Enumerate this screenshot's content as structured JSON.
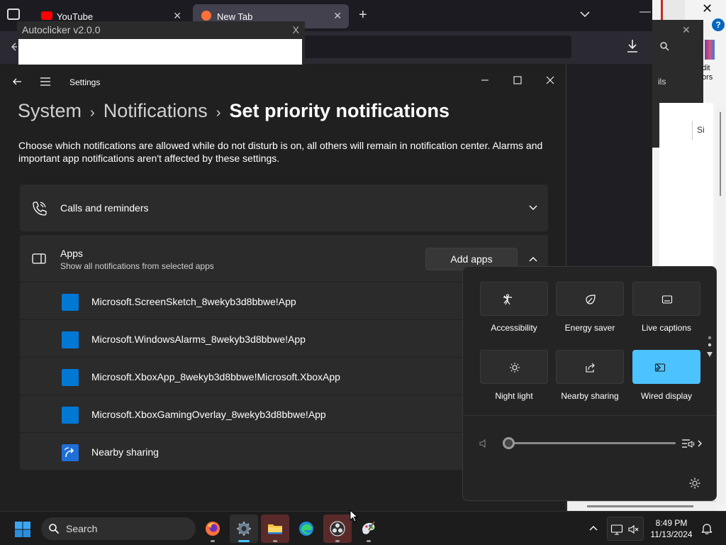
{
  "browser": {
    "tabs": [
      {
        "label": "YouTube",
        "favicon": "youtube-icon",
        "favicon_color": "#ff0000"
      },
      {
        "label": "New Tab",
        "favicon": "firefox-icon",
        "favicon_color": "#ff7139"
      }
    ],
    "tab_close": "✕",
    "new_tab": "+",
    "tab_list": "⌄",
    "minimize": "—"
  },
  "background_window": {
    "close": "✕",
    "inner_close": "✕",
    "help": "?",
    "edit_label": "dit\nors",
    "label_ils": "ils",
    "label_si": "Si"
  },
  "autoclicker": {
    "title": "Autoclicker v2.0.0",
    "close": "X"
  },
  "settings": {
    "app_title": "Settings",
    "breadcrumb": {
      "system": "System",
      "notifications": "Notifications",
      "current": "Set priority notifications",
      "separator": "›"
    },
    "description": "Choose which notifications are allowed while do not disturb is on, all others will remain in notification center. Alarms and important app notifications aren't affected by these settings.",
    "calls_label": "Calls and reminders",
    "apps_label": "Apps",
    "apps_sublabel": "Show all notifications from selected apps",
    "add_apps_button": "Add apps",
    "apps": [
      "Microsoft.ScreenSketch_8wekyb3d8bbwe!App",
      "Microsoft.WindowsAlarms_8wekyb3d8bbwe!App",
      "Microsoft.XboxApp_8wekyb3d8bbwe!Microsoft.XboxApp",
      "Microsoft.XboxGamingOverlay_8wekyb3d8bbwe!App",
      "Nearby sharing"
    ]
  },
  "quick_settings": {
    "tiles": [
      {
        "label": "Accessibility",
        "icon": "accessibility-icon",
        "active": false
      },
      {
        "label": "Energy saver",
        "icon": "energy-saver-icon",
        "active": false
      },
      {
        "label": "Live captions",
        "icon": "live-captions-icon",
        "active": false
      },
      {
        "label": "Night light",
        "icon": "night-light-icon",
        "active": false
      },
      {
        "label": "Nearby sharing",
        "icon": "nearby-sharing-icon",
        "active": false
      },
      {
        "label": "Wired display",
        "icon": "wired-display-icon",
        "active": true
      }
    ],
    "volume_level": 0,
    "accent": "#4cc2ff"
  },
  "taskbar": {
    "search_label": "Search",
    "time": "8:49 PM",
    "date": "11/13/2024",
    "apps": [
      "firefox-icon",
      "settings-icon",
      "file-explorer-icon",
      "edge-icon",
      "obs-icon",
      "paint-icon"
    ]
  }
}
